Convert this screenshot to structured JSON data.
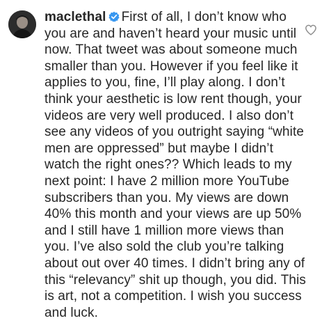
{
  "comment": {
    "username": "maclethal",
    "verified": true,
    "text": "First of all, I don’t know who you are and haven’t heard your music until now. That tweet was about someone much smaller than you. However if you feel like it applies to you, fine, I’ll play along. I don’t think your aesthetic is low rent though, your videos are very well produced. I also don’t see any videos of you outright saying “white men are oppressed” but maybe I didn’t watch the right ones?? Which leads to my next point: I have 2 million more YouTube subscribers than you. My views are down 40% this month and your views are up 50% and I still have 1 million more views than you. I’ve also sold the club you’re talking about out over 40 times. I didn’t bring any of this “relevancy” shit up though, you did. This is art, not a competition. I wish you success and luck."
  },
  "icons": {
    "verified": "verified-badge-icon",
    "like": "heart-icon",
    "verified_color": "#3897f0"
  }
}
